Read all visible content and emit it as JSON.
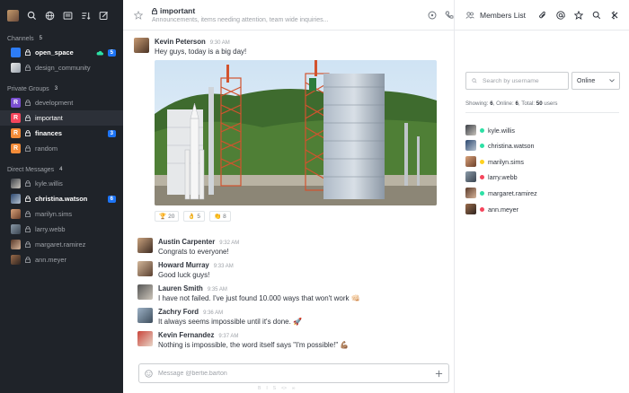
{
  "sidebar": {
    "sections": {
      "channels": {
        "label": "Channels",
        "count": "5"
      },
      "private": {
        "label": "Private Groups",
        "count": "3"
      },
      "direct": {
        "label": "Direct Messages",
        "count": "4"
      }
    },
    "channels": [
      {
        "label": "open_space",
        "badge": "5"
      },
      {
        "label": "design_community"
      }
    ],
    "groups": [
      {
        "label": "development",
        "letter": "R",
        "color": "#7a4fd1"
      },
      {
        "label": "important",
        "letter": "R",
        "color": "#f5455c"
      },
      {
        "label": "finances",
        "letter": "R",
        "color": "#f38c39",
        "badge": "3"
      },
      {
        "label": "random",
        "letter": "R",
        "color": "#f38c39"
      }
    ],
    "dms": [
      {
        "label": "kyle.willis"
      },
      {
        "label": "christina.watson",
        "badge": "6"
      },
      {
        "label": "marilyn.sims"
      },
      {
        "label": "larry.webb"
      },
      {
        "label": "margaret.ramirez"
      },
      {
        "label": "ann.meyer"
      }
    ]
  },
  "header": {
    "title": "important",
    "topic": "Announcements, items needing attention, team wide inquiries..."
  },
  "messages": [
    {
      "user": "Kevin Peterson",
      "time": "9:30 AM",
      "text": "Hey guys, today is a big day!"
    },
    {
      "user": "Austin Carpenter",
      "time": "9:32 AM",
      "text": "Congrats to everyone!"
    },
    {
      "user": "Howard Murray",
      "time": "9:33 AM",
      "text": "Good luck guys!"
    },
    {
      "user": "Lauren Smith",
      "time": "9:35 AM",
      "text": "I have not failed. I've just found 10.000 ways that won't work 👊🏻"
    },
    {
      "user": "Zachry Ford",
      "time": "9:36 AM",
      "text": "It always seems impossible until it's done. 🚀"
    },
    {
      "user": "Kevin Fernandez",
      "time": "9:37 AM",
      "text": "Nothing is impossible, the word itself says \"I'm possible!\" 💪🏽"
    }
  ],
  "reactions": [
    {
      "emoji": "🏆",
      "count": "20"
    },
    {
      "emoji": "👌",
      "count": "5"
    },
    {
      "emoji": "👏",
      "count": "8"
    }
  ],
  "composer": {
    "placeholder": "Message @bertie.barton"
  },
  "panel": {
    "title": "Members List",
    "search_placeholder": "Search by username",
    "status_filter": "Online",
    "stats": {
      "showing_label": "Showing:",
      "showing": "6",
      "online_label": "Online:",
      "online": "6",
      "total_label": "Total:",
      "total": "50",
      "suffix": "users"
    },
    "members": [
      {
        "name": "kyle.willis",
        "status_color": "#2de0a5"
      },
      {
        "name": "christina.watson",
        "status_color": "#2de0a5"
      },
      {
        "name": "marilyn.sims",
        "status_color": "#ffd21f"
      },
      {
        "name": "larry.webb",
        "status_color": "#f5455c"
      },
      {
        "name": "margaret.ramirez",
        "status_color": "#2de0a5"
      },
      {
        "name": "ann.meyer",
        "status_color": "#f5455c"
      }
    ]
  },
  "colors": {
    "sidebar_bg": "#1f2329",
    "accent": "#1d74f5",
    "online": "#2de0a5",
    "away": "#ffd21f",
    "busy": "#f5455c"
  }
}
